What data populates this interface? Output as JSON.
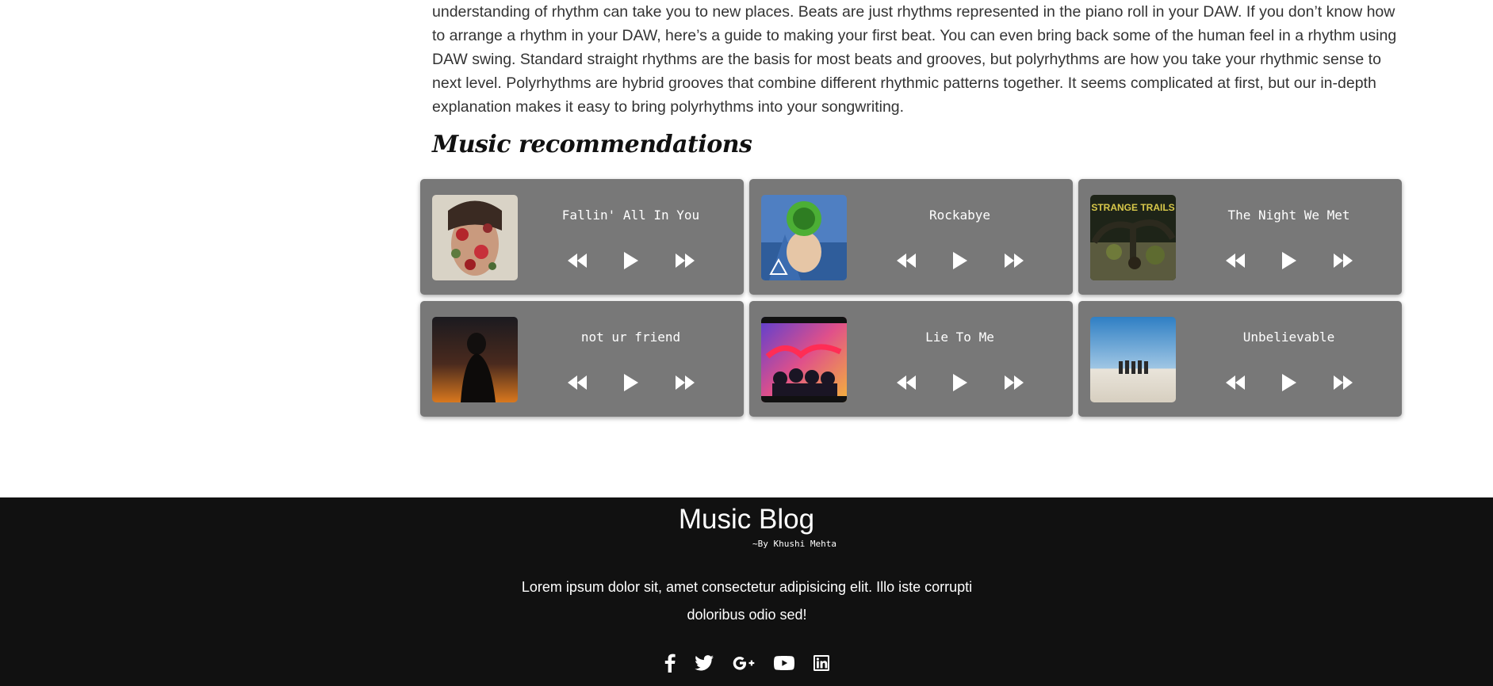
{
  "article": {
    "paragraph": "understanding of rhythm can take you to new places. Beats are just rhythms represented in the piano roll in your DAW. If you don’t know how to arrange a rhythm in your DAW, here’s a guide to making your first beat. You can even bring back some of the human feel in a rhythm using DAW swing. Standard straight rhythms are the basis for most beats and grooves, but polyrhythms are how you take your rhythmic sense to next level. Polyrhythms are hybrid grooves that combine different rhythmic patterns together. It seems complicated at first, but our in-depth explanation makes it easy to bring polyrhythms into your songwriting."
  },
  "recommendations": {
    "heading": "Music recommendations",
    "songs": [
      {
        "title": "Fallin' All In You",
        "cover": "album-cover-flowers-portrait"
      },
      {
        "title": "Rockabye",
        "cover": "album-cover-green-hair-figure"
      },
      {
        "title": "The Night We Met",
        "cover": "album-cover-strange-trails",
        "cover_text": "STRANGE TRAILS"
      },
      {
        "title": "not ur friend",
        "cover": "album-cover-sunset-silhouette"
      },
      {
        "title": "Lie To Me",
        "cover": "album-cover-youngblood"
      },
      {
        "title": "Unbelievable",
        "cover": "album-cover-desert-band"
      }
    ],
    "controls": [
      "rewind-icon",
      "play-icon",
      "fast-forward-icon"
    ]
  },
  "footer": {
    "title": "Music Blog",
    "author": "~By Khushi Mehta",
    "description": "Lorem ipsum dolor sit, amet consectetur adipisicing elit. Illo iste corrupti doloribus odio sed!",
    "socials": [
      "facebook-icon",
      "twitter-icon",
      "google-plus-icon",
      "youtube-icon",
      "linkedin-icon"
    ],
    "background": "#111111"
  },
  "colors": {
    "card_background": "#787878",
    "text": "#333333"
  }
}
